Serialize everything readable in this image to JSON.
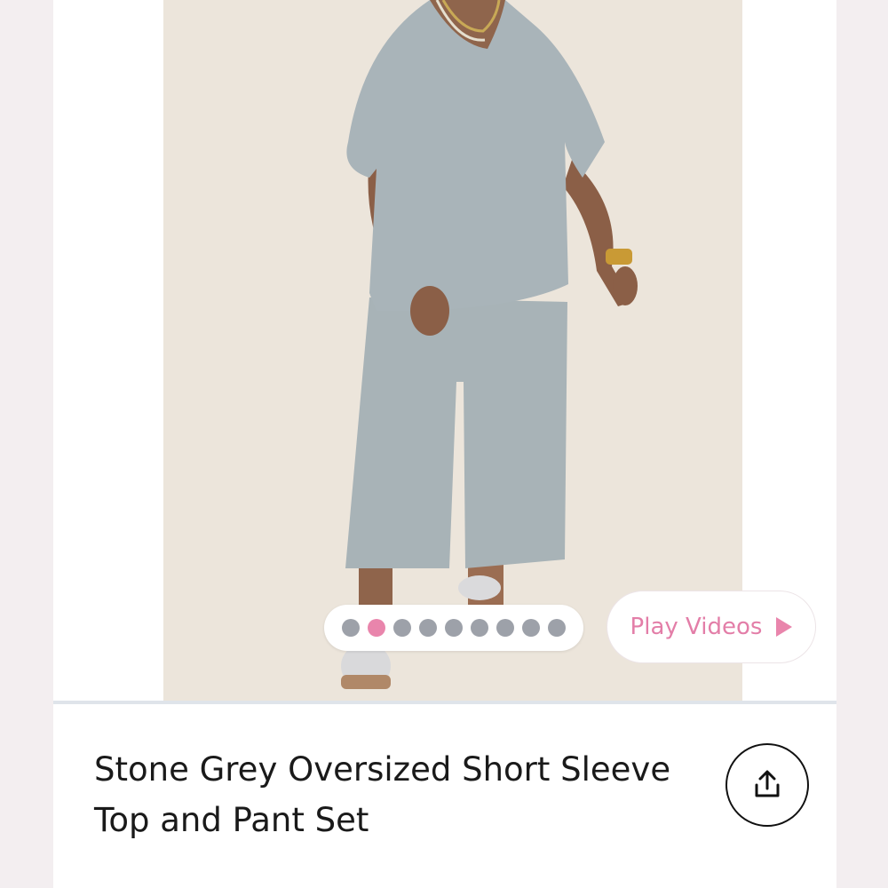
{
  "carousel": {
    "total_slides": 9,
    "active_index": 1,
    "dot_color": "#9da1a9",
    "active_dot_color": "#e985ac"
  },
  "play_videos": {
    "label": "Play Videos",
    "icon": "play-triangle-icon",
    "color": "#e37ea8"
  },
  "product": {
    "title": "Stone Grey Oversized Short Sleeve Top and Pant Set"
  },
  "share": {
    "icon": "share-upload-icon"
  }
}
